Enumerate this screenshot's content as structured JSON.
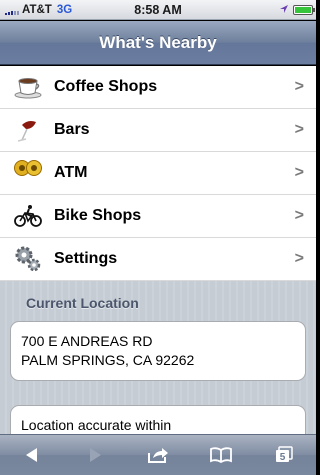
{
  "status_bar": {
    "carrier": "AT&T",
    "network": "3G",
    "time": "8:58 AM",
    "battery_level": 1.0
  },
  "title": "What's Nearby",
  "menu": [
    {
      "label": "Coffee Shops",
      "icon": "coffee-cup-icon"
    },
    {
      "label": "Bars",
      "icon": "wine-glass-icon"
    },
    {
      "label": "ATM",
      "icon": "coins-icon"
    },
    {
      "label": "Bike Shops",
      "icon": "bicycle-icon"
    },
    {
      "label": "Settings",
      "icon": "gears-icon"
    }
  ],
  "chevron": ">",
  "current_location": {
    "heading": "Current Location",
    "address_line1": "700 E ANDREAS RD",
    "address_line2": "PALM SPRINGS, CA 92262"
  },
  "accuracy_text": "Location accurate within",
  "toolbar": {
    "tabs_count": "5",
    "icons": [
      "back-arrow-icon",
      "forward-arrow-icon",
      "share-icon",
      "bookmarks-icon",
      "tabs-icon"
    ]
  },
  "colors": {
    "titlebar": "#6d7f9c",
    "background": "#c5ccd4",
    "section_label": "#4c566c",
    "network": "#2b59d6",
    "battery": "#35c43a"
  }
}
